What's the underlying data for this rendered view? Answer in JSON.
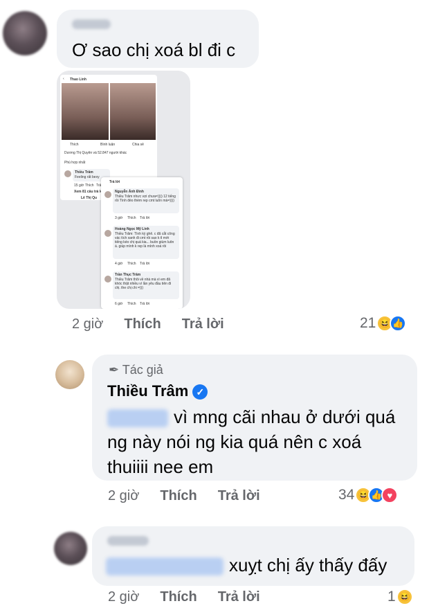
{
  "comments": [
    {
      "text": "Ơ sao chị xoá bl đi c",
      "embed": {
        "profile_name": "Thao Linh",
        "post_actions": [
          "Thích",
          "Bình luận",
          "Chia sẻ"
        ],
        "likes_line": "Dương Thị Quyên và 52.847 người khác",
        "sort": "Phù hợp nhất",
        "comment_name": "Thiều Trâm",
        "comment_text": "Feeling rất bexy",
        "comment_meta": [
          "15 giờ",
          "Thích",
          "Trả lời"
        ],
        "more_replies": "Xem 81 câu trả lời trước",
        "reply_name": "Lê Thị Qu",
        "reply_header": "Trả lời",
        "replies": [
          {
            "name": "Nguyễn Ánh Đình",
            "text": "Thiều Trâm nhưc vợi chưa=)))) 12 tiếng rồi Tình đéo thèm rep cmt luôn mà=))))",
            "meta": [
              "3 giờ",
              "Thích",
              "Trả lời"
            ]
          },
          {
            "name": "Hoàng Ngọc Mỹ Linh",
            "text": "Thiều Trâm: Tình kỳ ghê. c đã cắt công vác tích xanh đi cmt rồi sao k tl mới tiếng kéo chị quá kia... buồn giùm luôn á. giúp mình k rep là mình xoá rồi",
            "meta": [
              "4 giờ",
              "Thích",
              "Trả lời"
            ]
          },
          {
            "name": "Trần Thục Trâm",
            "text": "Thiều Trâm thôi về nhà mà vì em đã khóc thật nhiều vì lần yêu đầu tiên đi chị. the chị chi =)))",
            "meta": [
              "6 giờ",
              "Thích",
              "Trả lời"
            ]
          }
        ]
      },
      "time": "2 giờ",
      "like": "Thích",
      "reply": "Trả lời",
      "reaction_count": "21",
      "reactions": [
        "haha-icon",
        "like-icon"
      ]
    },
    {
      "badge": "Tác giả",
      "author": "Thiều Trâm",
      "text_line1": "vì mng cãi nhau ở dưới quá",
      "text_line2": "ng này nói ng kia quá nên c xoá",
      "text_line3": "thuiiii nee em",
      "time": "2 giờ",
      "like": "Thích",
      "reply": "Trả lời",
      "reaction_count": "34",
      "reactions": [
        "haha-icon",
        "like-icon",
        "love-icon"
      ]
    },
    {
      "text": "xuỵt chị ấy thấy đấy",
      "time": "2 giờ",
      "like": "Thích",
      "reply": "Trả lời",
      "reaction_count": "1",
      "reactions": [
        "haha-icon"
      ]
    }
  ],
  "colors": {
    "bubble": "#f0f2f5",
    "meta": "#65676b",
    "like": "#1877f2",
    "haha": "#f7c23a",
    "love": "#f3425f"
  }
}
